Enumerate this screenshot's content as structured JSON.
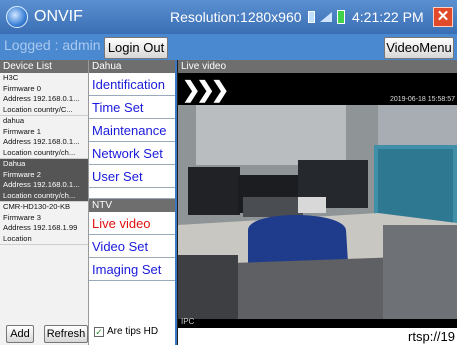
{
  "status": {
    "app_title": "ONVIF",
    "resolution": "Resolution:1280x960",
    "time": "4:21:22 PM"
  },
  "topbar": {
    "logged": "Logged : admin",
    "login_out": "Login Out",
    "video_menu": "VideoMenu"
  },
  "device_list": {
    "header": "Device List",
    "devices": [
      {
        "name": "H3C",
        "firmware": "Firmware 0",
        "address": "Address 192.168.0.1...",
        "location": "Location country/C..."
      },
      {
        "name": "dahua",
        "firmware": "Firmware 1",
        "address": "Address 192.168.0.1...",
        "location": "Location country/ch..."
      },
      {
        "name": "Dahua",
        "firmware": "Firmware 2",
        "address": "Address 192.168.0.1...",
        "location": "Location country/ch..."
      },
      {
        "name": "CMR-HD130-20-KB",
        "firmware": "Firmware 3",
        "address": "Address 192.168.1.99",
        "location": "Location"
      }
    ],
    "add": "Add",
    "refresh": "Refresh"
  },
  "menu": {
    "header": "Dahua",
    "items": [
      "Identification",
      "Time Set",
      "Maintenance",
      "Network Set",
      "User Set"
    ],
    "sub_header": "NTV",
    "sub_items": [
      "Live video",
      "Video Set",
      "Imaging Set"
    ],
    "tips_label": "Are tips HD"
  },
  "video": {
    "header": "Live video",
    "timestamp": "2019-06-18 15:58:57",
    "ipc_label": "IPC",
    "rtsp": "rtsp://19"
  },
  "colors": {
    "statusbar": "#3b6fb5",
    "actionbar": "#4a88cf",
    "menu_text": "#1a1adb",
    "menu_active": "#e01010",
    "close": "#e14b2a"
  }
}
